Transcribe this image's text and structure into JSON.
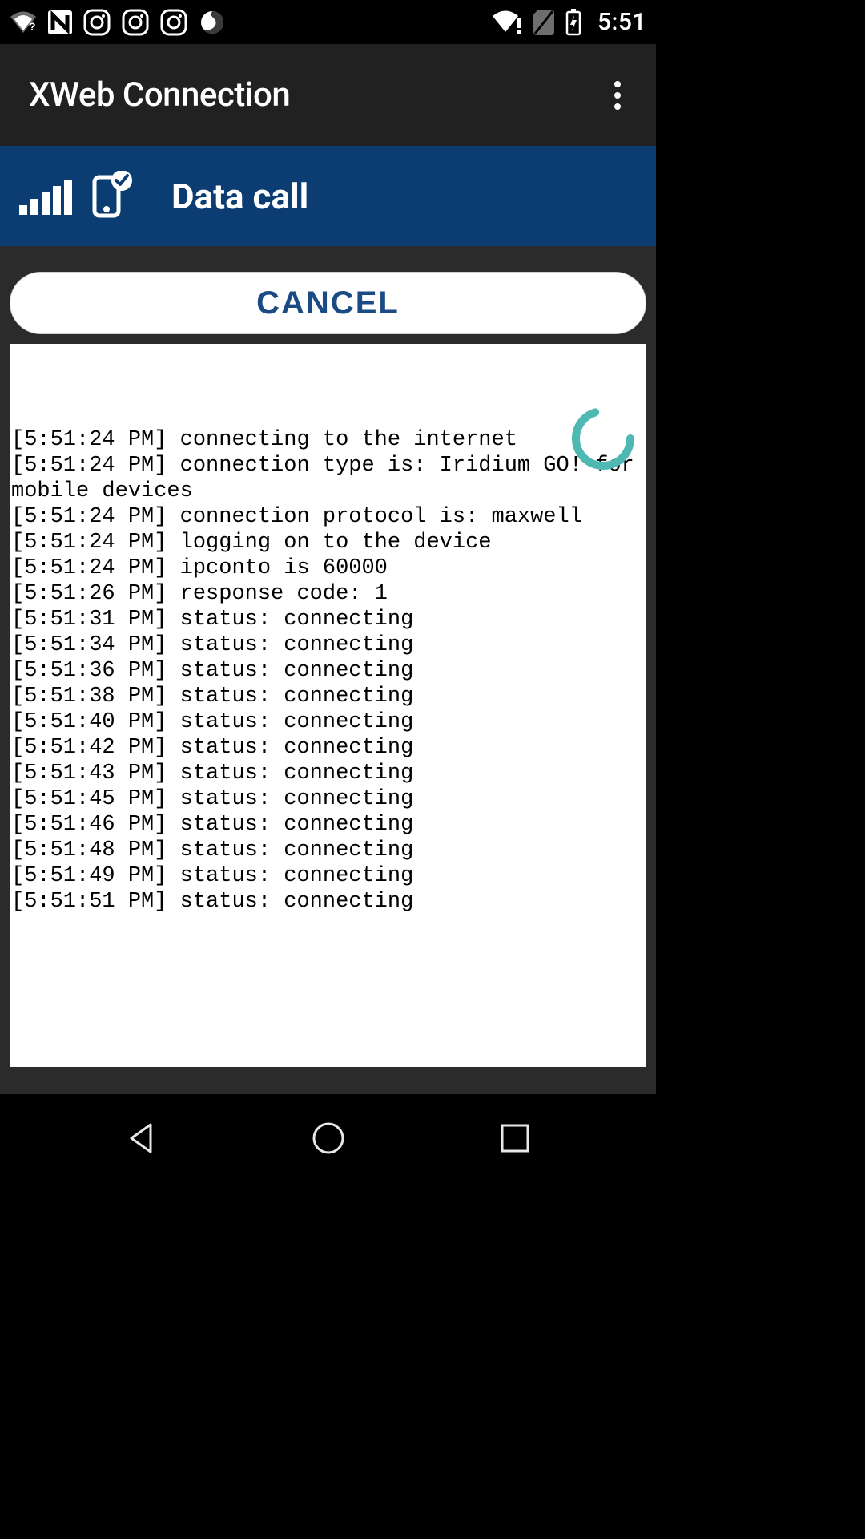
{
  "statusbar": {
    "clock": "5:51",
    "icons_left": [
      "wifi-q-icon",
      "n-icon",
      "ig-icon",
      "ig-icon",
      "ig-icon",
      "firefox-icon"
    ],
    "icons_right": [
      "wifi-alert-icon",
      "no-sim-icon",
      "battery-charging-icon"
    ]
  },
  "appbar": {
    "title": "XWeb Connection"
  },
  "banner": {
    "title": "Data call"
  },
  "buttons": {
    "cancel": "CANCEL"
  },
  "log": [
    "[5:51:24 PM] connecting to the internet",
    "[5:51:24 PM] connection type is: Iridium GO! for mobile devices",
    "[5:51:24 PM] connection protocol is: maxwell",
    "[5:51:24 PM] logging on to the device",
    "[5:51:24 PM] ipconto is 60000",
    "[5:51:26 PM] response code: 1",
    "[5:51:31 PM] status: connecting",
    "[5:51:34 PM] status: connecting",
    "[5:51:36 PM] status: connecting",
    "[5:51:38 PM] status: connecting",
    "[5:51:40 PM] status: connecting",
    "[5:51:42 PM] status: connecting",
    "[5:51:43 PM] status: connecting",
    "[5:51:45 PM] status: connecting",
    "[5:51:46 PM] status: connecting",
    "[5:51:48 PM] status: connecting",
    "[5:51:49 PM] status: connecting",
    "[5:51:51 PM] status: connecting"
  ],
  "colors": {
    "banner_bg": "#0b3d72",
    "cancel_text": "#1a4b85",
    "spinner": "#4fb8b2"
  }
}
